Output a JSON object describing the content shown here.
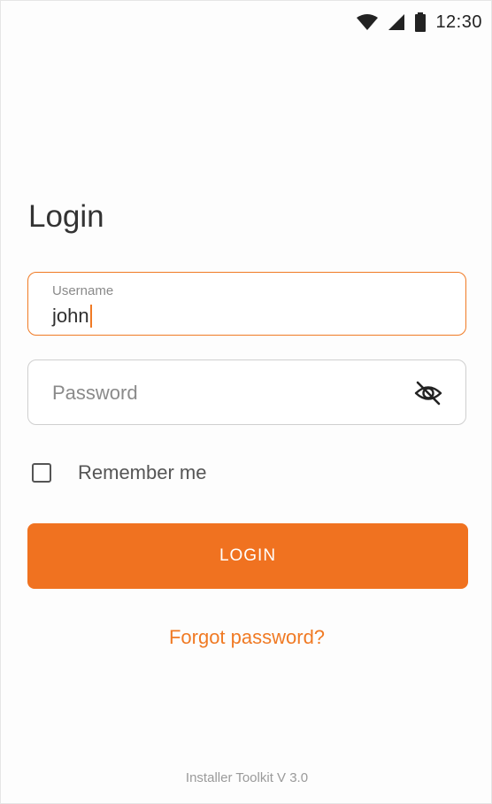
{
  "status_bar": {
    "time": "12:30",
    "icons": [
      "wifi-icon",
      "signal-icon",
      "battery-icon"
    ]
  },
  "login": {
    "title": "Login",
    "username": {
      "label": "Username",
      "value": "john"
    },
    "password": {
      "placeholder": "Password",
      "toggle_icon": "eye-off-icon"
    },
    "remember_me": {
      "label": "Remember me",
      "checked": false
    },
    "submit_label": "LOGIN",
    "forgot_password_label": "Forgot password?"
  },
  "footer": {
    "version": "Installer Toolkit V 3.0"
  },
  "colors": {
    "accent": "#f07220",
    "text": "#333333",
    "muted": "#8a8a8a",
    "border": "#cfcfcf"
  }
}
